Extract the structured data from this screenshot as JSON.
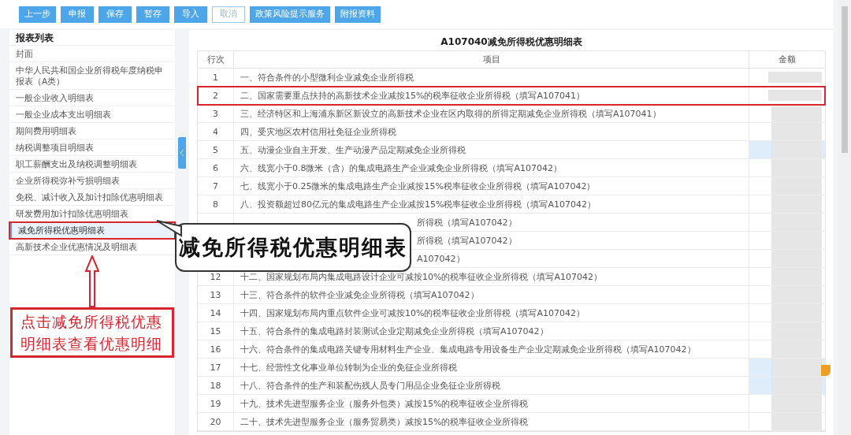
{
  "toolbar": {
    "buttons": [
      {
        "label": "上一步",
        "kind": "primary"
      },
      {
        "label": "申报",
        "kind": "primary"
      },
      {
        "label": "保存",
        "kind": "primary"
      },
      {
        "label": "暂存",
        "kind": "primary"
      },
      {
        "label": "导入",
        "kind": "primary"
      },
      {
        "label": "取消",
        "kind": "outline"
      },
      {
        "label": "政策风险提示服务",
        "kind": "primary"
      },
      {
        "label": "附报资料",
        "kind": "primary"
      }
    ]
  },
  "sidebar": {
    "title": "报表列表",
    "items": [
      {
        "label": "封面",
        "selected": false
      },
      {
        "label": "中华人民共和国企业所得税年度纳税申报表（A类）",
        "selected": false
      },
      {
        "label": "一般企业收入明细表",
        "selected": false
      },
      {
        "label": "一般企业成本支出明细表",
        "selected": false
      },
      {
        "label": "期间费用明细表",
        "selected": false
      },
      {
        "label": "纳税调整项目明细表",
        "selected": false
      },
      {
        "label": "职工薪酬支出及纳税调整明细表",
        "selected": false
      },
      {
        "label": "企业所得税弥补亏损明细表",
        "selected": false
      },
      {
        "label": "免税、减计收入及加计扣除优惠明细表",
        "selected": false
      },
      {
        "label": "研发费用加计扣除优惠明细表",
        "selected": false
      },
      {
        "label": "减免所得税优惠明细表",
        "selected": true
      },
      {
        "label": "高新技术企业优惠情况及明细表",
        "selected": false
      }
    ]
  },
  "table": {
    "title": "A107040减免所得税优惠明细表",
    "columns": [
      "行次",
      "项目",
      "金额"
    ],
    "rows": [
      {
        "row": "1",
        "item": "一、符合条件的小型微利企业减免企业所得税",
        "highlighted": false,
        "marked": false
      },
      {
        "row": "2",
        "item": "二、国家需要重点扶持的高新技术企业减按15%的税率征收企业所得税（填写A107041）",
        "highlighted": false,
        "marked": true
      },
      {
        "row": "3",
        "item": "三、经济特区和上海浦东新区新设立的高新技术企业在区内取得的所得定期减免企业所得税（填写A107041）",
        "highlighted": false,
        "marked": false
      },
      {
        "row": "4",
        "item": "四、受灾地区农村信用社免征企业所得税",
        "highlighted": false,
        "marked": false
      },
      {
        "row": "5",
        "item": "五、动漫企业自主开发、生产动漫产品定期减免企业所得税",
        "highlighted": true,
        "marked": false
      },
      {
        "row": "6",
        "item": "六、线宽小于0.8微米（含）的集成电路生产企业减免企业所得税（填写A107042）",
        "highlighted": false,
        "marked": false
      },
      {
        "row": "7",
        "item": "七、线宽小于0.25微米的集成电路生产企业减按15%税率征收企业所得税（填写A107042）",
        "highlighted": false,
        "marked": false
      },
      {
        "row": "8",
        "item": "八、投资额超过80亿元的集成电路生产企业减按15%税率征收企业所得税（填写A107042）",
        "highlighted": false,
        "marked": false
      },
      {
        "item": "所得税（填写A107042）",
        "highlighted": false,
        "marked": false
      },
      {
        "item": "所得税（填写A107042）",
        "highlighted": false,
        "marked": false
      },
      {
        "item": "A107042）",
        "highlighted": false,
        "marked": false
      },
      {
        "row": "12",
        "item": "十二、国家规划布局内集成电路设计企业可减按10%的税率征收企业所得税（填写A107042）",
        "highlighted": false,
        "marked": false
      },
      {
        "row": "13",
        "item": "十三、符合条件的软件企业减免企业所得税（填写A107042）",
        "highlighted": false,
        "marked": false
      },
      {
        "row": "14",
        "item": "十四、国家规划布局内重点软件企业可减按10%的税率征收企业所得税（填写A107042）",
        "highlighted": false,
        "marked": false
      },
      {
        "row": "15",
        "item": "十五、符合条件的集成电路封装测试企业定期减免企业所得税（填写A107042）",
        "highlighted": false,
        "marked": false
      },
      {
        "row": "16",
        "item": "十六、符合条件的集成电路关键专用材料生产企业、集成电路专用设备生产企业定期减免企业所得税（填写A107042）",
        "highlighted": false,
        "marked": false
      },
      {
        "row": "17",
        "item": "十七、经营性文化事业单位转制为企业的免征企业所得税",
        "highlighted": true,
        "marked": false
      },
      {
        "row": "18",
        "item": "十八、符合条件的生产和装配伤残人员专门用品企业免征企业所得税",
        "highlighted": true,
        "marked": false
      },
      {
        "row": "19",
        "item": "十九、技术先进型服务企业（服务外包类）减按15%的税率征收企业所得税",
        "highlighted": false,
        "marked": false
      },
      {
        "row": "20",
        "item": "二十、技术先进型服务企业（服务贸易类）减按15%的税率征收企业所得税",
        "highlighted": false,
        "marked": false
      }
    ]
  },
  "annotations": {
    "callout": "减免所得税优惠明细表",
    "note": "点击减免所得税优惠明细表查看优惠明细"
  }
}
